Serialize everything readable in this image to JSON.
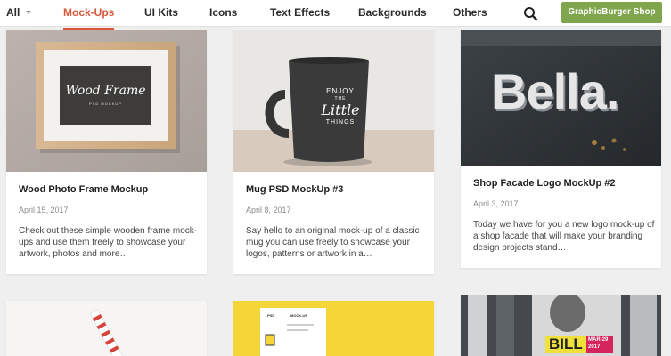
{
  "nav": {
    "items": [
      {
        "label": "All"
      },
      {
        "label": "Mock-Ups"
      },
      {
        "label": "UI Kits"
      },
      {
        "label": "Icons"
      },
      {
        "label": "Text Effects"
      },
      {
        "label": "Backgrounds"
      },
      {
        "label": "Others"
      }
    ],
    "active": "Mock-Ups",
    "search_icon": "search-icon",
    "shop_button": "GraphicBurger Shop",
    "colors": {
      "active": "#d9573d",
      "shop_button": "#7fa54d"
    }
  },
  "cards": [
    {
      "title": "Wood Photo Frame Mockup",
      "date": "April 15, 2017",
      "excerpt": "Check out these simple wooden frame mock-ups and use them freely to showcase your artwork, photos and more…",
      "image_text": {
        "line1": "Wood Frame",
        "line2": "PSD MOCKUP"
      }
    },
    {
      "title": "Mug PSD MockUp #3",
      "date": "April 8, 2017",
      "excerpt": "Say hello to an original mock-up of a classic mug you can use freely to showcase your logos, patterns or artwork in a…",
      "image_text": {
        "line1": "ENJOY",
        "line2": "THE",
        "line3": "Little",
        "line4": "THINGS"
      }
    },
    {
      "title": "Shop Facade Logo MockUp #2",
      "date": "April 3, 2017",
      "excerpt": "Today we have for you a new logo mock-up of a shop facade that will make your branding design projects stand…",
      "image_text": {
        "line1": "Bella."
      }
    }
  ],
  "bottom_cards": [
    {
      "image": "straw-image"
    },
    {
      "image_text": {
        "line1": "PSD",
        "line2": "MOCK-UP"
      }
    },
    {
      "image_text": {
        "line1": "BILL",
        "line2": "MAR-29",
        "line3": "2017"
      }
    }
  ]
}
